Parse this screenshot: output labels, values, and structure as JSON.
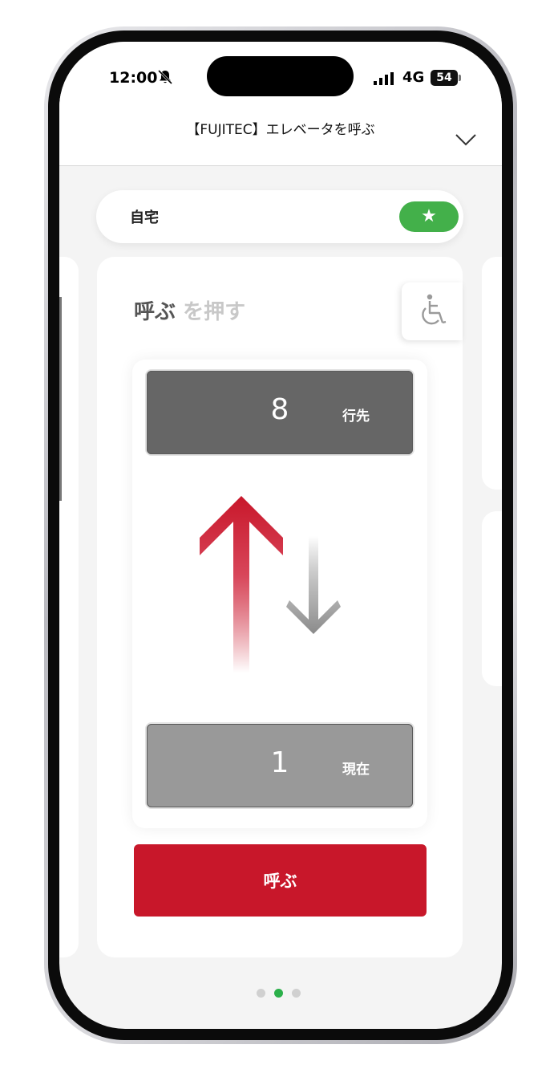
{
  "status_bar": {
    "time": "12:00",
    "network": "4G",
    "battery": "54"
  },
  "header": {
    "title": "【FUJITEC】エレベータを呼ぶ"
  },
  "favorite": {
    "label": "自宅",
    "toggle_icon": "★",
    "toggle_color": "#43b04a"
  },
  "call_panel": {
    "instruction_bold": "呼ぶ",
    "instruction_light": "を押す",
    "destination": {
      "floor": "8",
      "tag": "行先"
    },
    "current": {
      "floor": "1",
      "tag": "現在"
    },
    "call_button_label": "呼ぶ",
    "accent_color": "#c8172a"
  },
  "pagination": {
    "total": 3,
    "active_index": 1
  }
}
